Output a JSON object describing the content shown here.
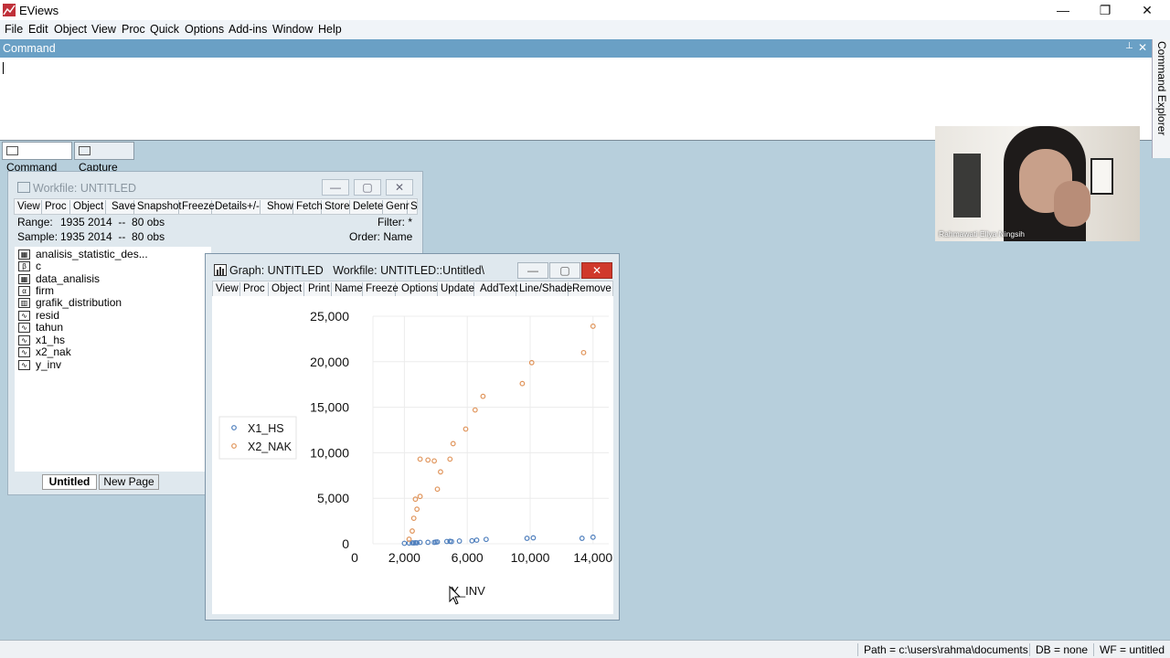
{
  "app": {
    "title": "EViews",
    "minimize": "—",
    "maximize": "❐",
    "close": "✕"
  },
  "menubar": [
    "File",
    "Edit",
    "Object",
    "View",
    "Proc",
    "Quick",
    "Options",
    "Add-ins",
    "Window",
    "Help"
  ],
  "command": {
    "title": "Command",
    "pin": "📌",
    "close": "✕",
    "tabs": [
      "Command",
      "Capture"
    ],
    "explorer_label": "Command Explorer"
  },
  "webcam": {
    "participant_name": "Rahmawati Ellya Ningsih"
  },
  "workfile": {
    "title": "Workfile: UNTITLED",
    "toolbar": [
      "View",
      "Proc",
      "Object",
      "Save",
      "Snapshot",
      "Freeze",
      "Details+/-",
      "Show",
      "Fetch",
      "Store",
      "Delete",
      "Genr",
      "Sa"
    ],
    "range_label": "Range:",
    "range_value": "1935 2014  --  80 obs",
    "sample_label": "Sample:",
    "sample_value": "1935 2014  --  80 obs",
    "filter_label": "Filter: *",
    "order_label": "Order: Name",
    "objects": [
      {
        "name": "analisis_statistic_des...",
        "icon": "table-icon"
      },
      {
        "name": "c",
        "icon": "coef-icon"
      },
      {
        "name": "data_analisis",
        "icon": "table-icon"
      },
      {
        "name": "firm",
        "icon": "series-alpha-icon"
      },
      {
        "name": "grafik_distribution",
        "icon": "graph-icon"
      },
      {
        "name": "resid",
        "icon": "series-icon"
      },
      {
        "name": "tahun",
        "icon": "series-icon"
      },
      {
        "name": "x1_hs",
        "icon": "series-icon"
      },
      {
        "name": "x2_nak",
        "icon": "series-icon"
      },
      {
        "name": "y_inv",
        "icon": "series-icon"
      }
    ],
    "tabs": [
      "Untitled",
      "New Page"
    ]
  },
  "graph": {
    "title": "Graph: UNTITLED   Workfile: UNTITLED::Untitled\\",
    "toolbar": [
      "View",
      "Proc",
      "Object",
      "Print",
      "Name",
      "Freeze",
      "Options",
      "Update",
      "AddText",
      "Line/Shade",
      "Remove"
    ]
  },
  "chart_data": {
    "type": "scatter",
    "xlabel": "Y_INV",
    "ylabel": "",
    "xlim": [
      0,
      15000
    ],
    "ylim": [
      0,
      25000
    ],
    "x_ticks": [
      "0",
      "2,000",
      "6,000",
      "10,000",
      "14,000"
    ],
    "x_tick_values": [
      0,
      2000,
      6000,
      10000,
      14000
    ],
    "y_ticks": [
      "0",
      "5,000",
      "10,000",
      "15,000",
      "20,000",
      "25,000"
    ],
    "y_tick_values": [
      0,
      5000,
      10000,
      15000,
      20000,
      25000
    ],
    "legend_position": "left",
    "series": [
      {
        "name": "X1_HS",
        "color": "#4f7fbd",
        "points": [
          [
            2000,
            50
          ],
          [
            2300,
            80
          ],
          [
            2500,
            100
          ],
          [
            2600,
            90
          ],
          [
            2700,
            110
          ],
          [
            2800,
            100
          ],
          [
            3000,
            150
          ],
          [
            3500,
            160
          ],
          [
            3900,
            150
          ],
          [
            4000,
            180
          ],
          [
            4100,
            200
          ],
          [
            4700,
            250
          ],
          [
            4900,
            270
          ],
          [
            5000,
            240
          ],
          [
            5500,
            300
          ],
          [
            6300,
            330
          ],
          [
            6600,
            400
          ],
          [
            7200,
            480
          ],
          [
            9800,
            600
          ],
          [
            10200,
            650
          ],
          [
            13300,
            600
          ],
          [
            14000,
            720
          ]
        ]
      },
      {
        "name": "X2_NAK",
        "color": "#e0945a",
        "points": [
          [
            2300,
            500
          ],
          [
            2500,
            1400
          ],
          [
            2600,
            2800
          ],
          [
            2700,
            4900
          ],
          [
            2800,
            3800
          ],
          [
            3000,
            5200
          ],
          [
            3000,
            9300
          ],
          [
            3500,
            9200
          ],
          [
            3900,
            9100
          ],
          [
            4100,
            6000
          ],
          [
            4300,
            7900
          ],
          [
            4900,
            9300
          ],
          [
            5100,
            11000
          ],
          [
            5900,
            12600
          ],
          [
            6500,
            14700
          ],
          [
            7000,
            16200
          ],
          [
            9500,
            17600
          ],
          [
            10100,
            19900
          ],
          [
            13400,
            21000
          ],
          [
            14000,
            23900
          ]
        ]
      }
    ]
  },
  "statusbar": {
    "path": "Path = c:\\users\\rahma\\documents",
    "db": "DB = none",
    "wf": "WF = untitled"
  }
}
